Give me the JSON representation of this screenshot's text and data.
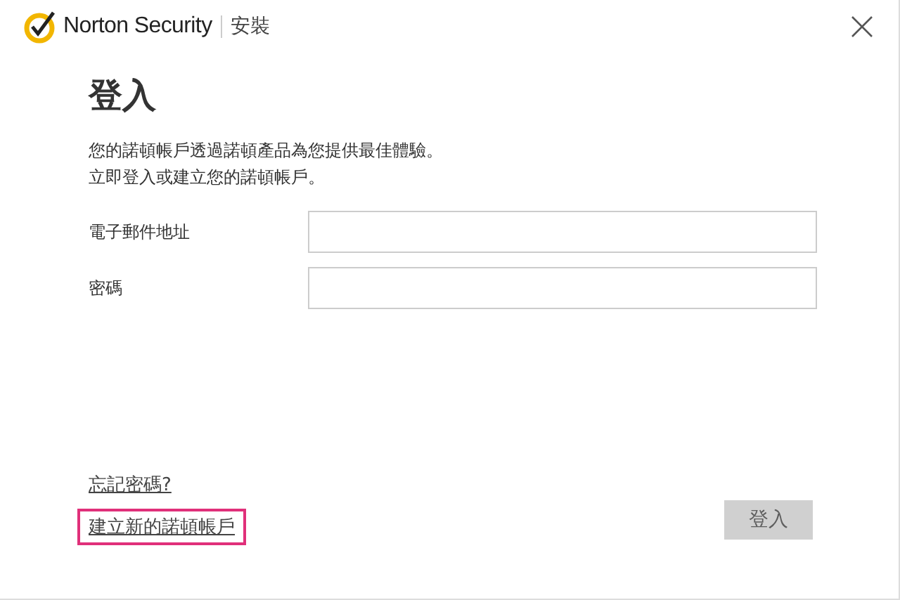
{
  "header": {
    "brand": "Norton Security",
    "section": "安裝"
  },
  "title": "登入",
  "intro": [
    "您的諾頓帳戶透過諾頓產品為您提供最佳體驗。",
    "立即登入或建立您的諾頓帳戶。"
  ],
  "fields": [
    {
      "label": "電子郵件地址"
    },
    {
      "label": "密碼"
    }
  ],
  "links": [
    {
      "label": "忘記密碼?",
      "highlighted": false
    },
    {
      "label": "建立新的諾頓帳戶",
      "highlighted": true
    }
  ],
  "sign_in_button": {
    "label": "登入",
    "disabled": true
  }
}
